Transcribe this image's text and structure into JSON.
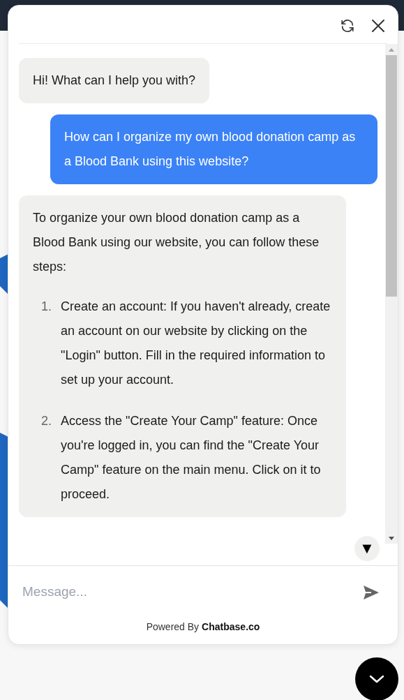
{
  "chat": {
    "header_buttons": [
      {
        "kind": "refresh"
      },
      {
        "kind": "close"
      }
    ],
    "messages": [
      {
        "kind": "bot",
        "paragraphs": [
          "Hi! What can I help you with?"
        ]
      },
      {
        "kind": "user",
        "paragraphs": [
          "How can I organize my own blood donation camp as a Blood Bank using this website?"
        ]
      },
      {
        "kind": "bot",
        "paragraphs": [
          "To organize your own blood donation camp as a Blood Bank using our website, you can follow these steps:"
        ],
        "steps": [
          {
            "number": "1.",
            "text": "Create an account: If you haven't already, create an account on our website by clicking on the \"Login\" button. Fill in the required information to set up your account."
          },
          {
            "number": "2.",
            "text": "Access the \"Create Your Camp\" feature: Once you're logged in, you can find the \"Create Your Camp\" feature on the main menu. Click on it to proceed."
          }
        ]
      }
    ],
    "scroll_down_button": "▼",
    "input": {
      "placeholder": "Message..."
    },
    "footer": {
      "prefix": "Powered By",
      "brand": "Chatbase.co"
    }
  }
}
